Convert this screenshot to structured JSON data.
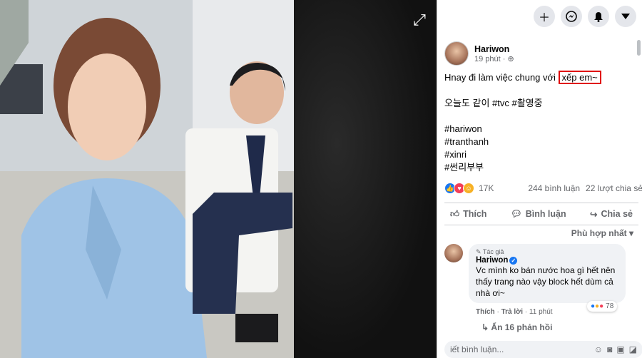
{
  "topbar": {
    "icons": [
      "plus-icon",
      "messenger-icon",
      "bell-icon",
      "caret-down-icon"
    ]
  },
  "post": {
    "author": "Hariwon",
    "time": "19 phút",
    "line1_pre": "Hnay đi làm việc chung với ",
    "line1_highlight": "xếp em~",
    "line2": "오늘도 같이 #tvc #촬영중",
    "tags": [
      "#hariwon",
      "#tranthanh",
      "#xinri",
      "#썬리부부"
    ]
  },
  "stats": {
    "reactions": "17K",
    "comments": "244 bình luận",
    "shares": "22 lượt chia sẻ"
  },
  "actions": {
    "like": "Thích",
    "comment": "Bình luận",
    "share": "Chia sẻ"
  },
  "sort_label": "Phù hợp nhất",
  "comment": {
    "badge": "Tác giả",
    "name": "Hariwon",
    "text": "Vc mình ko bán nước hoa gì hết nên thấy trang nào vậy block hết dùm cả nhà ơi~",
    "like": "Thích",
    "reply": "Trả lời",
    "time": "11 phút",
    "reaction_count": "78",
    "hide_replies": "Ẩn 16 phản hồi"
  },
  "compose": {
    "placeholder": "iết bình luận..."
  },
  "colors": {
    "accent": "#1877f2",
    "highlight_box": "#e00000"
  }
}
